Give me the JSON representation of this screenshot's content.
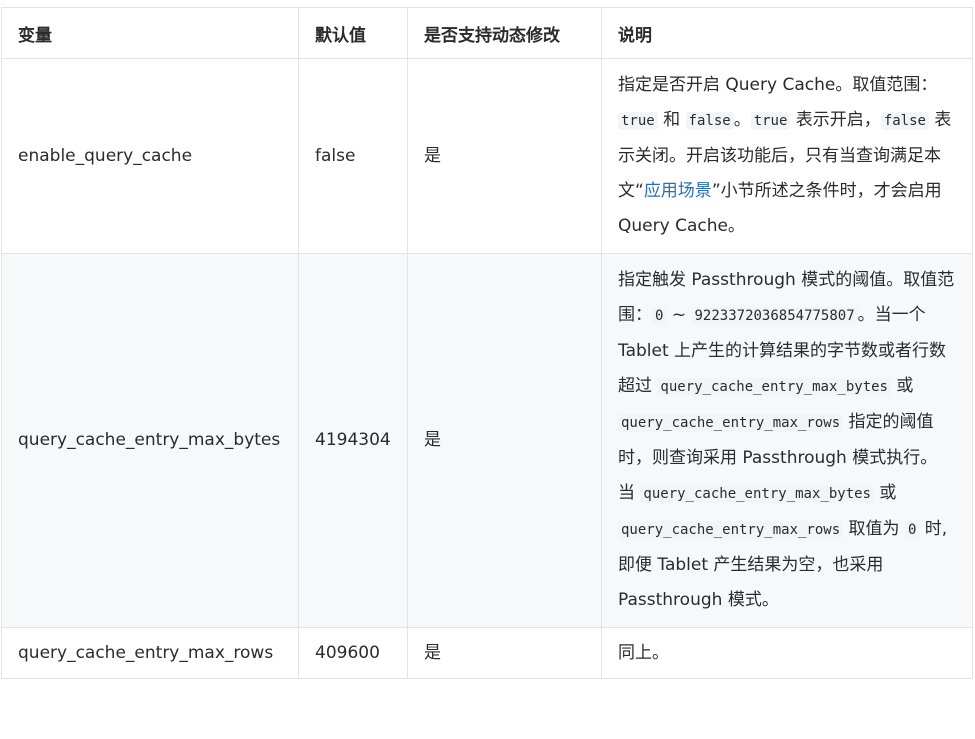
{
  "headers": [
    "变量",
    "默认值",
    "是否支持动态修改",
    "说明"
  ],
  "rows": [
    {
      "name": "enable_query_cache",
      "default": "false",
      "dynamic": "是",
      "desc": {
        "t1": "指定是否开启 Query Cache。取值范围：",
        "c1": "true",
        "t2": " 和 ",
        "c2": "false",
        "t3": "。",
        "c3": "true",
        "t4": " 表示开启，",
        "c4": "false",
        "t5": " 表示关闭。开启该功能后，只有当查询满足本文“",
        "link": "应用场景",
        "t6": "”小节所述之条件时，才会启用 Query Cache。"
      }
    },
    {
      "name": "query_cache_entry_max_bytes",
      "default": "4194304",
      "dynamic": "是",
      "desc": {
        "t1": "指定触发 Passthrough 模式的阈值。取值范围：",
        "c1": "0",
        "t2": " ~ ",
        "c2": "9223372036854775807",
        "t3": "。当一个 Tablet 上产生的计算结果的字节数或者行数超过 ",
        "c3": "query_cache_entry_max_bytes",
        "t4": " 或 ",
        "c4": "query_cache_entry_max_rows",
        "t5": " 指定的阈值时，则查询采用 Passthrough 模式执行。",
        "p2_t1": "当 ",
        "p2_c1": "query_cache_entry_max_bytes",
        "p2_t2": " 或 ",
        "p2_c2": "query_cache_entry_max_rows",
        "p2_t3": " 取值为 ",
        "p2_c3": "0",
        "p2_t4": " 时, 即便 Tablet 产生结果为空，也采用 Passthrough 模式。"
      }
    },
    {
      "name": "query_cache_entry_max_rows",
      "default": "409600",
      "dynamic": "是",
      "desc": {
        "t1": "同上。"
      }
    }
  ]
}
